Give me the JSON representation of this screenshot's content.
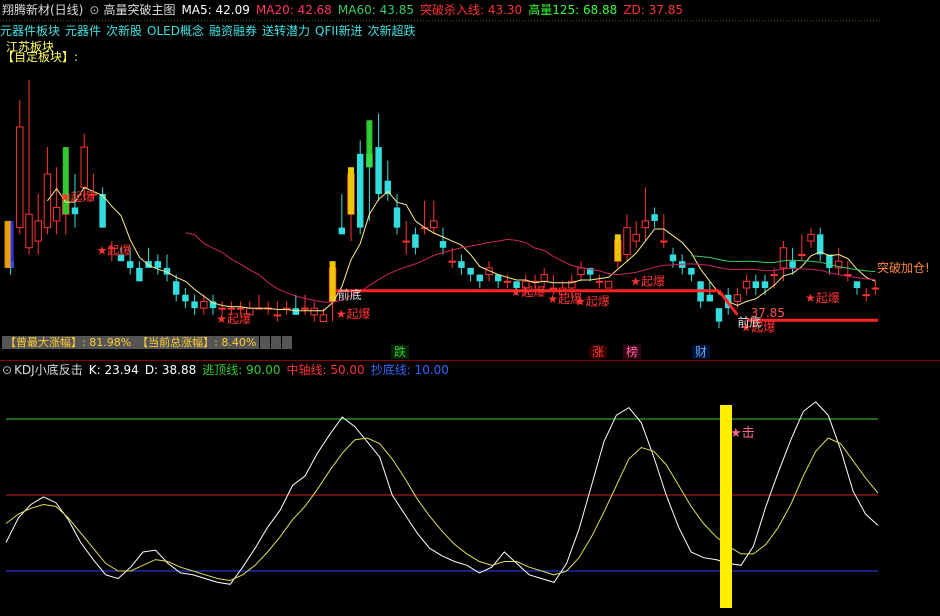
{
  "header": {
    "gear_icon": "gear-icon",
    "stock_name": "翔腾新材(日线)",
    "indicator_name": "高量突破主图",
    "ma5": {
      "label": "MA5: 42.09",
      "color": "#ffffff"
    },
    "ma20": {
      "label": "MA20: 42.68",
      "color": "#ff3366"
    },
    "ma60": {
      "label": "MA60: 43.85",
      "color": "#33cc66"
    },
    "breakout": {
      "label": "突破杀入线: 43.30",
      "color": "#ff3333"
    },
    "vol125": {
      "label": "高量125: 68.88",
      "color": "#33ff33"
    },
    "zd": {
      "label": "ZD: 37.85",
      "color": "#ff3333"
    }
  },
  "blocks": {
    "prefix": "元器件板块",
    "items": [
      "元器件",
      "次新股",
      "OLED概念",
      "融资融券",
      "送转潜力",
      "QFII新进",
      "次新超跌"
    ],
    "label": "江苏板块",
    "self_label": "【自定板块】:"
  },
  "info_bar": {
    "max_gain": "【曾最大涨幅】: 81.98%",
    "total_gain": "【当前总涨幅】: 8.40%"
  },
  "event_markers": [
    {
      "text": "跌",
      "color": "#33cc33",
      "bg": "#003300"
    },
    {
      "text": "涨",
      "color": "#ff3333",
      "bg": "#330000"
    },
    {
      "text": "榜",
      "color": "#ff66aa",
      "bg": "#330011"
    },
    {
      "text": "财",
      "color": "#66aaff",
      "bg": "#001133"
    }
  ],
  "kdj": {
    "name": "KDJ小底反击",
    "k": "K: 23.94",
    "d": "D: 38.88",
    "escape": {
      "label": "逃顶线: 90.00",
      "color": "#33cc33"
    },
    "mid": {
      "label": "中轴线: 50.00",
      "color": "#ff3333"
    },
    "bottom": {
      "label": "抄底线: 10.00",
      "color": "#3366ff"
    }
  },
  "annotations": {
    "qibao": "★起爆",
    "qiandi": "前底",
    "tupo": "突破加仓!",
    "ji": "★击",
    "price_label": "37.85"
  },
  "chart_data": [
    {
      "type": "candlestick",
      "ohlc": [
        [
          43,
          49,
          41,
          42
        ],
        [
          48,
          67,
          47,
          63
        ],
        [
          45,
          70,
          44,
          50
        ],
        [
          46,
          53,
          44,
          49
        ],
        [
          48,
          60,
          47,
          56
        ],
        [
          49,
          57,
          47,
          51
        ],
        [
          50,
          60,
          47,
          53
        ],
        [
          51,
          56,
          48,
          50
        ],
        [
          54,
          62,
          52,
          60
        ],
        [
          53,
          56,
          52,
          53
        ],
        [
          53,
          54,
          48,
          48
        ],
        [
          45,
          46,
          43,
          45
        ],
        [
          44,
          45,
          43,
          43
        ],
        [
          43,
          45,
          41,
          42
        ],
        [
          42,
          43,
          40,
          40
        ],
        [
          43,
          45,
          42,
          42
        ],
        [
          43,
          44,
          41,
          42
        ],
        [
          42,
          44,
          40,
          41
        ],
        [
          40,
          41,
          37,
          38
        ],
        [
          38,
          39,
          36,
          37
        ],
        [
          37,
          38,
          35,
          36
        ],
        [
          36,
          38,
          35,
          37
        ],
        [
          37,
          38,
          35,
          36
        ],
        [
          36,
          37,
          35,
          36
        ],
        [
          36,
          37,
          35,
          36
        ],
        [
          36,
          37,
          35,
          36
        ],
        [
          35,
          37,
          35,
          36
        ],
        [
          36,
          38,
          36,
          36
        ],
        [
          36,
          37,
          35,
          36
        ],
        [
          35,
          37,
          34,
          35
        ],
        [
          36,
          37,
          35,
          36
        ],
        [
          36,
          38,
          35,
          35
        ],
        [
          36,
          38,
          35,
          36
        ],
        [
          35,
          37,
          34,
          36
        ],
        [
          34,
          36,
          34,
          35
        ],
        [
          37,
          43,
          34,
          42
        ],
        [
          48,
          53,
          47,
          47
        ],
        [
          50,
          57,
          46,
          56
        ],
        [
          59,
          61,
          47,
          48
        ],
        [
          59,
          64,
          49,
          57
        ],
        [
          60,
          65,
          52,
          53
        ],
        [
          55,
          58,
          52,
          53
        ],
        [
          51,
          53,
          47,
          48
        ],
        [
          46,
          49,
          44,
          46
        ],
        [
          47,
          48,
          44,
          45
        ],
        [
          48,
          52,
          47,
          48
        ],
        [
          48,
          52,
          47,
          49
        ],
        [
          46,
          48,
          44,
          45
        ],
        [
          43,
          45,
          42,
          43
        ],
        [
          43,
          44,
          41,
          42
        ],
        [
          42,
          42,
          40,
          41
        ],
        [
          41,
          41,
          39,
          40
        ],
        [
          41,
          43,
          40,
          42
        ],
        [
          41,
          41,
          39,
          40
        ],
        [
          40,
          41,
          39,
          40
        ],
        [
          40,
          40,
          38,
          39
        ],
        [
          39,
          41,
          38,
          40
        ],
        [
          40,
          41,
          39,
          40
        ],
        [
          40,
          42,
          39,
          41
        ],
        [
          39,
          41,
          38,
          39
        ],
        [
          38,
          40,
          38,
          39
        ],
        [
          39,
          41,
          38,
          40
        ],
        [
          41,
          43,
          40,
          42
        ],
        [
          42,
          42,
          40,
          41
        ],
        [
          40,
          41,
          39,
          40
        ],
        [
          39,
          40,
          39,
          40
        ],
        [
          43,
          47,
          42,
          46
        ],
        [
          44,
          50,
          43,
          48
        ],
        [
          46,
          49,
          45,
          47
        ],
        [
          48,
          54,
          46,
          49
        ],
        [
          50,
          51,
          48,
          49
        ],
        [
          46,
          50,
          45,
          46
        ],
        [
          44,
          45,
          42,
          43
        ],
        [
          43,
          44,
          41,
          42
        ],
        [
          42,
          42,
          40,
          41
        ],
        [
          40,
          40,
          36,
          37
        ],
        [
          38,
          40,
          37,
          37
        ],
        [
          36,
          36,
          33,
          34
        ],
        [
          38,
          39,
          35,
          36
        ],
        [
          37,
          39,
          36,
          38
        ],
        [
          39,
          41,
          38,
          40
        ],
        [
          40,
          41,
          38,
          39
        ],
        [
          40,
          41,
          38,
          39
        ],
        [
          41,
          42,
          39,
          41
        ],
        [
          42,
          46,
          40,
          45
        ],
        [
          43,
          45,
          41,
          42
        ],
        [
          44,
          47,
          43,
          44
        ],
        [
          46,
          48,
          45,
          47
        ],
        [
          47,
          48,
          43,
          44
        ],
        [
          44,
          44,
          41,
          42
        ],
        [
          42,
          45,
          41,
          43
        ],
        [
          41,
          43,
          40,
          41
        ],
        [
          40,
          40,
          38,
          39
        ],
        [
          38,
          39,
          37,
          38
        ],
        [
          39,
          40,
          38,
          39
        ]
      ],
      "ma5_trend": "white",
      "ma20_trend": "pink",
      "support_lines": [
        {
          "value": 38.6,
          "from": 55,
          "to": 700
        },
        {
          "value": 37.85,
          "from": 715,
          "to": 878
        }
      ],
      "breakout_markers": [
        "起爆",
        "起爆",
        "起爆",
        "起爆",
        "起爆",
        "起爆",
        "起爆",
        "起爆",
        "起爆"
      ]
    },
    {
      "type": "line",
      "title": "KDJ小底反击",
      "series": [
        {
          "name": "K",
          "values": [
            25,
            38,
            45,
            49,
            46,
            37,
            25,
            16,
            8,
            6,
            12,
            20,
            21,
            14,
            9,
            8,
            6,
            4,
            3,
            12,
            22,
            33,
            42,
            55,
            60,
            72,
            82,
            91,
            86,
            78,
            70,
            50,
            40,
            30,
            22,
            18,
            15,
            13,
            9,
            12,
            20,
            14,
            8,
            6,
            4,
            14,
            32,
            55,
            78,
            92,
            96,
            88,
            70,
            50,
            33,
            20,
            17,
            16,
            14,
            13,
            23,
            44,
            62,
            79,
            94,
            99,
            92,
            74,
            52,
            40,
            34
          ]
        },
        {
          "name": "D",
          "values": [
            35,
            40,
            43,
            45,
            44,
            38,
            30,
            22,
            14,
            10,
            10,
            13,
            16,
            15,
            12,
            10,
            8,
            6,
            5,
            8,
            13,
            20,
            28,
            37,
            44,
            53,
            63,
            72,
            79,
            80,
            77,
            69,
            59,
            48,
            39,
            31,
            24,
            19,
            15,
            13,
            15,
            15,
            12,
            10,
            8,
            10,
            17,
            28,
            41,
            55,
            69,
            75,
            73,
            66,
            55,
            44,
            35,
            28,
            23,
            19,
            19,
            24,
            33,
            45,
            60,
            73,
            80,
            77,
            68,
            59,
            51
          ]
        }
      ],
      "reference_lines": [
        90,
        50,
        10
      ],
      "ylim": [
        0,
        100
      ]
    }
  ]
}
